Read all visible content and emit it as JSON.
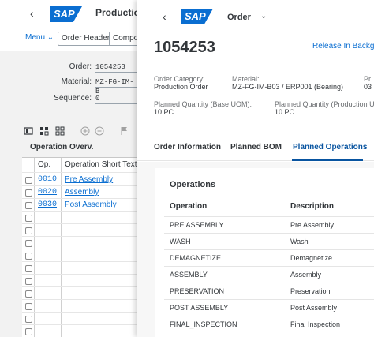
{
  "background_window": {
    "back_glyph": "‹",
    "logo_text": "SAP",
    "title": "Production",
    "toolbar": {
      "menu_label": "Menu",
      "menu_chevron": "⌄",
      "order_header_label": "Order Header",
      "components_label": "Compon"
    },
    "fields": [
      {
        "label": "Order:",
        "value": "1054253"
      },
      {
        "label": "Material:",
        "value": "MZ-FG-IM-B"
      },
      {
        "label": "Sequence:",
        "value": "0"
      }
    ],
    "table_title": "Operation Overv.",
    "table_headers": {
      "op": "Op.",
      "text": "Operation Short Text"
    },
    "rows": [
      {
        "op": "0010",
        "text": "Pre Assembly"
      },
      {
        "op": "0020",
        "text": "Assembly"
      },
      {
        "op": "0030",
        "text": "Post Assembly"
      }
    ],
    "icons": [
      "details-icon",
      "grid-icon",
      "layout-icon",
      "add-icon",
      "remove-icon",
      "flag-icon"
    ]
  },
  "foreground_panel": {
    "back_glyph": "‹",
    "logo_text": "SAP",
    "app_title": "Order",
    "app_chevron": "⌄",
    "order_number": "1054253",
    "header_action": "Release In Backgro",
    "attributes": {
      "category_label": "Order Category:",
      "category_value": "Production Order",
      "material_label": "Material:",
      "material_value": "MZ-FG-IM-B03 / ERP001 (Bearing)",
      "third_label": "Pr",
      "third_value": "03",
      "planned_base_label": "Planned Quantity (Base UOM):",
      "planned_base_value": "10 PC",
      "planned_prod_label": "Planned Quantity (Production U",
      "planned_prod_value": "10 PC"
    },
    "tabs": [
      {
        "label": "Order Information",
        "active": false
      },
      {
        "label": "Planned BOM",
        "active": false
      },
      {
        "label": "Planned Operations",
        "active": true
      }
    ],
    "operations": {
      "title": "Operations",
      "columns": {
        "operation": "Operation",
        "description": "Description"
      },
      "rows": [
        {
          "operation": "PRE ASSEMBLY",
          "description": "Pre Assembly"
        },
        {
          "operation": "WASH",
          "description": "Wash"
        },
        {
          "operation": "DEMAGNETIZE",
          "description": "Demagnetize"
        },
        {
          "operation": "ASSEMBLY",
          "description": "Assembly"
        },
        {
          "operation": "PRESERVATION",
          "description": "Preservation"
        },
        {
          "operation": "POST ASSEMBLY",
          "description": "Post Assembly"
        },
        {
          "operation": "FINAL_INSPECTION",
          "description": "Final Inspection"
        }
      ]
    }
  },
  "colors": {
    "brand": "#0a6ed1",
    "active_tab": "#0854a0",
    "link": "#0a6ed1"
  }
}
